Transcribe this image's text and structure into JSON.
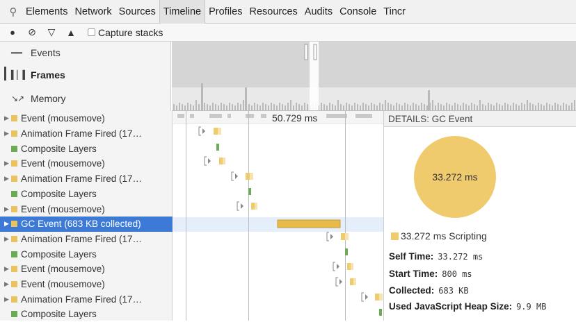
{
  "tabs": [
    "Elements",
    "Network",
    "Sources",
    "Timeline",
    "Profiles",
    "Resources",
    "Audits",
    "Console",
    "Tincr"
  ],
  "active_tab": "Timeline",
  "toolbar": {
    "capture_label": "Capture stacks"
  },
  "overview": {
    "items": [
      {
        "label": "Events",
        "icon": "events-icon"
      },
      {
        "label": "Frames",
        "icon": "frames-icon"
      },
      {
        "label": "Memory",
        "icon": "memory-icon"
      }
    ],
    "selected": "Frames"
  },
  "records": [
    {
      "label": "Event (mousemove)",
      "color": "#e8c35f",
      "expandable": true
    },
    {
      "label": "Animation Frame Fired (17…",
      "color": "#e8c35f",
      "expandable": true
    },
    {
      "label": "Composite Layers",
      "color": "#6cab55",
      "expandable": false
    },
    {
      "label": "Event (mousemove)",
      "color": "#e8c35f",
      "expandable": true
    },
    {
      "label": "Animation Frame Fired (17…",
      "color": "#e8c35f",
      "expandable": true
    },
    {
      "label": "Composite Layers",
      "color": "#6cab55",
      "expandable": false
    },
    {
      "label": "Event (mousemove)",
      "color": "#e8c35f",
      "expandable": true
    },
    {
      "label": "GC Event (683 KB collected)",
      "color": "#e8c35f",
      "expandable": false,
      "selected": true
    },
    {
      "label": "Animation Frame Fired (17…",
      "color": "#e8c35f",
      "expandable": true
    },
    {
      "label": "Composite Layers",
      "color": "#6cab55",
      "expandable": false
    },
    {
      "label": "Event (mousemove)",
      "color": "#e8c35f",
      "expandable": true
    },
    {
      "label": "Event (mousemove)",
      "color": "#e8c35f",
      "expandable": true
    },
    {
      "label": "Animation Frame Fired (17…",
      "color": "#e8c35f",
      "expandable": true
    },
    {
      "label": "Composite Layers",
      "color": "#6cab55",
      "expandable": false
    }
  ],
  "waterfall": {
    "ruler_label": "50.729 ms"
  },
  "details": {
    "header": "DETAILS: GC Event",
    "pie_label": "33.272 ms",
    "legend": "33.272 ms Scripting",
    "self_time_key": "Self Time:",
    "self_time_val": "33.272 ms",
    "start_time_key": "Start Time:",
    "start_time_val": "800 ms",
    "collected_key": "Collected:",
    "collected_val": "683 KB",
    "heap_key": "Used JavaScript Heap Size:",
    "heap_val": "9.9 MB"
  },
  "colors": {
    "scripting": "#efcb6e",
    "rendering": "#6cab55",
    "selection": "#3d7ad6"
  }
}
